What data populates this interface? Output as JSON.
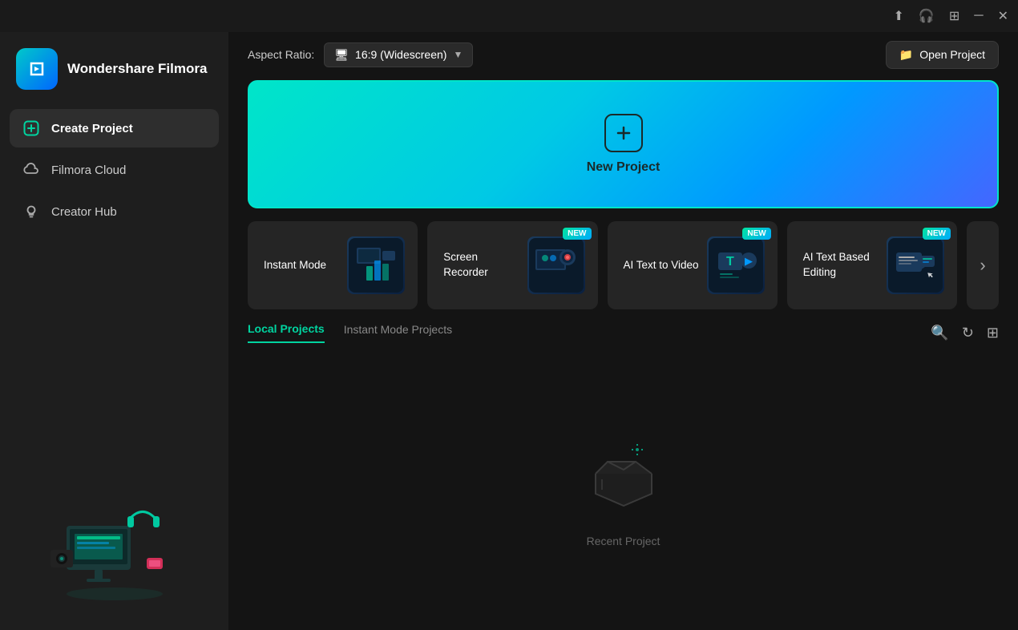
{
  "titlebar": {
    "icons": [
      "upload-icon",
      "headset-icon",
      "grid-icon",
      "minimize-icon",
      "close-icon"
    ]
  },
  "sidebar": {
    "logo": {
      "name": "Wondershare\nFilmora"
    },
    "nav": [
      {
        "id": "create-project",
        "label": "Create Project",
        "icon": "plus-circle",
        "active": true
      },
      {
        "id": "filmora-cloud",
        "label": "Filmora Cloud",
        "icon": "cloud",
        "active": false
      },
      {
        "id": "creator-hub",
        "label": "Creator Hub",
        "icon": "lightbulb",
        "active": false
      }
    ]
  },
  "header": {
    "aspect_ratio_label": "Aspect Ratio:",
    "aspect_ratio_value": "16:9 (Widescreen)",
    "open_project_label": "Open Project"
  },
  "new_project": {
    "label": "New Project"
  },
  "feature_cards": [
    {
      "id": "instant-mode",
      "label": "Instant Mode",
      "badge": null,
      "icon": "🎬"
    },
    {
      "id": "screen-recorder",
      "label": "Screen Recorder",
      "badge": "NEW",
      "icon": "🎥"
    },
    {
      "id": "ai-text-to-video",
      "label": "AI Text to Video",
      "badge": "NEW",
      "icon": "🤖"
    },
    {
      "id": "ai-text-editing",
      "label": "AI Text Based Editing",
      "badge": "NEW",
      "icon": "✏️"
    },
    {
      "id": "more",
      "label": "",
      "badge": null,
      "icon": "›"
    }
  ],
  "projects": {
    "tabs": [
      {
        "id": "local",
        "label": "Local Projects",
        "active": true
      },
      {
        "id": "instant",
        "label": "Instant Mode Projects",
        "active": false
      }
    ],
    "actions": [
      "search",
      "refresh",
      "view-toggle"
    ],
    "empty_label": "Recent Project"
  }
}
